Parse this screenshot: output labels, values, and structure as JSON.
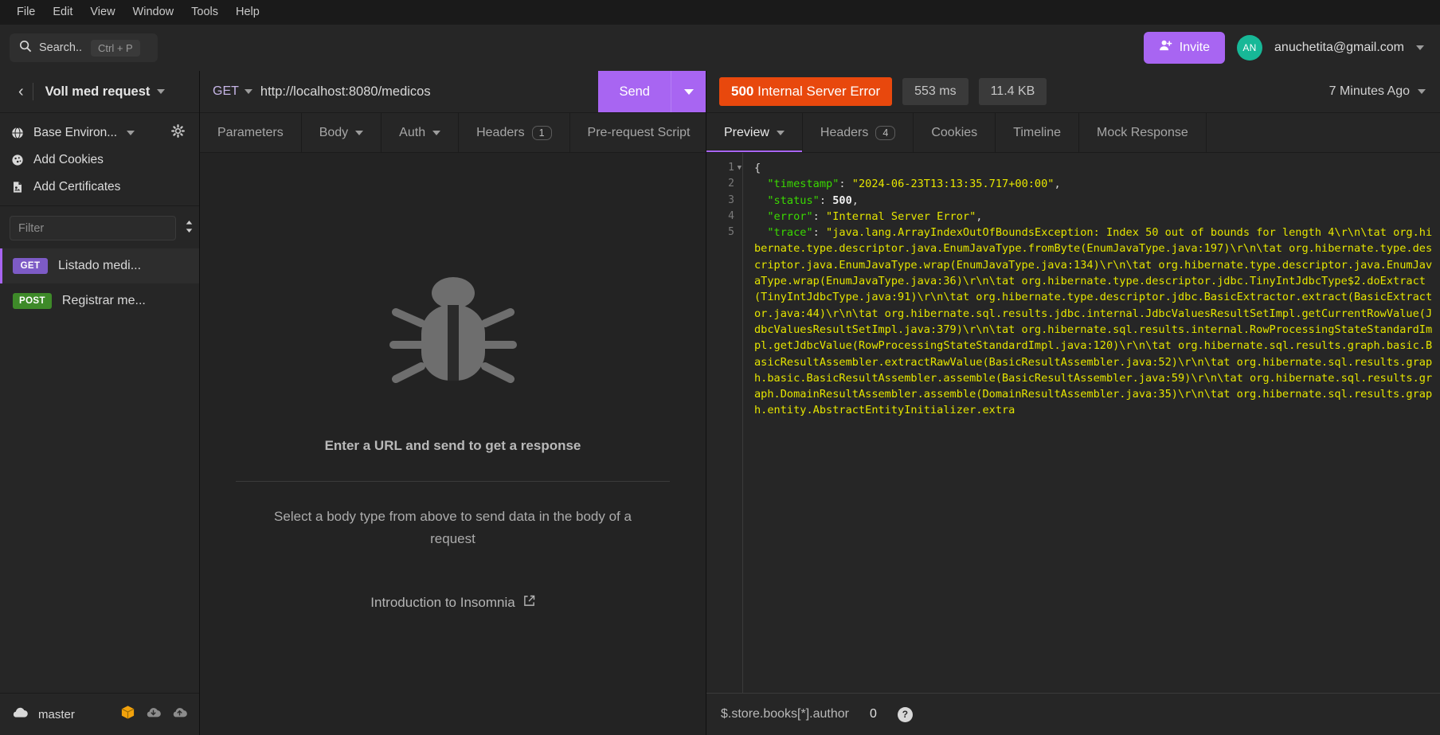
{
  "menubar": {
    "items": [
      "File",
      "Edit",
      "View",
      "Window",
      "Tools",
      "Help"
    ]
  },
  "topbar": {
    "search": {
      "label": "Search..",
      "shortcut": "Ctrl + P"
    },
    "invite_label": "Invite",
    "account": {
      "initials": "AN",
      "email": "anuchetita@gmail.com"
    }
  },
  "sidebar": {
    "workspace_name": "Voll med request",
    "environment": {
      "label": "Base Environ..."
    },
    "cookies_label": "Add Cookies",
    "certificates_label": "Add Certificates",
    "filter_placeholder": "Filter",
    "requests": [
      {
        "method": "GET",
        "name": "Listado medi...",
        "active": true
      },
      {
        "method": "POST",
        "name": "Registrar me...",
        "active": false
      }
    ],
    "footer": {
      "branch": "master"
    }
  },
  "request": {
    "method": "GET",
    "url": "http://localhost:8080/medicos",
    "send_label": "Send",
    "tabs": [
      {
        "label": "Parameters",
        "badge": null,
        "caret": false,
        "active": false
      },
      {
        "label": "Body",
        "badge": null,
        "caret": true,
        "active": false
      },
      {
        "label": "Auth",
        "badge": null,
        "caret": true,
        "active": false
      },
      {
        "label": "Headers",
        "badge": "1",
        "caret": false,
        "active": false
      },
      {
        "label": "Pre-request Script",
        "badge": null,
        "caret": false,
        "active": false
      }
    ],
    "empty_state": {
      "title": "Enter a URL and send to get a response",
      "subtitle": "Select a body type from above to send data in the body of a request",
      "link": "Introduction to Insomnia"
    }
  },
  "response": {
    "status_code": "500",
    "status_text": "Internal Server Error",
    "time": "553 ms",
    "size": "11.4 KB",
    "age": "7 Minutes Ago",
    "tabs": [
      {
        "label": "Preview",
        "badge": null,
        "caret": true,
        "active": true
      },
      {
        "label": "Headers",
        "badge": "4",
        "caret": false,
        "active": false
      },
      {
        "label": "Cookies",
        "badge": null,
        "caret": false,
        "active": false
      },
      {
        "label": "Timeline",
        "badge": null,
        "caret": false,
        "active": false
      },
      {
        "label": "Mock Response",
        "badge": null,
        "caret": false,
        "active": false
      }
    ],
    "line_numbers": [
      "1",
      "2",
      "3",
      "4",
      "5"
    ],
    "json": {
      "timestamp_key": "\"timestamp\"",
      "timestamp_value": "\"2024-06-23T13:13:35.717+00:00\"",
      "status_key": "\"status\"",
      "status_value": "500",
      "error_key": "\"error\"",
      "error_value": "\"Internal Server Error\"",
      "trace_key": "\"trace\"",
      "trace_value": "\"java.lang.ArrayIndexOutOfBoundsException: Index 50 out of bounds for length 4\\r\\n\\tat org.hibernate.type.descriptor.java.EnumJavaType.fromByte(EnumJavaType.java:197)\\r\\n\\tat org.hibernate.type.descriptor.java.EnumJavaType.wrap(EnumJavaType.java:134)\\r\\n\\tat org.hibernate.type.descriptor.java.EnumJavaType.wrap(EnumJavaType.java:36)\\r\\n\\tat org.hibernate.type.descriptor.jdbc.TinyIntJdbcType$2.doExtract(TinyIntJdbcType.java:91)\\r\\n\\tat org.hibernate.type.descriptor.jdbc.BasicExtractor.extract(BasicExtractor.java:44)\\r\\n\\tat org.hibernate.sql.results.jdbc.internal.JdbcValuesResultSetImpl.getCurrentRowValue(JdbcValuesResultSetImpl.java:379)\\r\\n\\tat org.hibernate.sql.results.internal.RowProcessingStateStandardImpl.getJdbcValue(RowProcessingStateStandardImpl.java:120)\\r\\n\\tat org.hibernate.sql.results.graph.basic.BasicResultAssembler.extractRawValue(BasicResultAssembler.java:52)\\r\\n\\tat org.hibernate.sql.results.graph.basic.BasicResultAssembler.assemble(BasicResultAssembler.java:59)\\r\\n\\tat org.hibernate.sql.results.graph.DomainResultAssembler.assemble(DomainResultAssembler.java:35)\\r\\n\\tat org.hibernate.sql.results.graph.entity.AbstractEntityInitializer.extra"
    },
    "footer": {
      "jsonpath": "$.store.books[*].author",
      "count": "0",
      "help": "?"
    }
  },
  "colors": {
    "accent": "#a865f2",
    "error": "#e8480d",
    "get": "#7d5bc6",
    "post": "#3e8a29",
    "avatar": "#17b897",
    "json_key": "#3ad900",
    "json_string": "#e5e500"
  }
}
